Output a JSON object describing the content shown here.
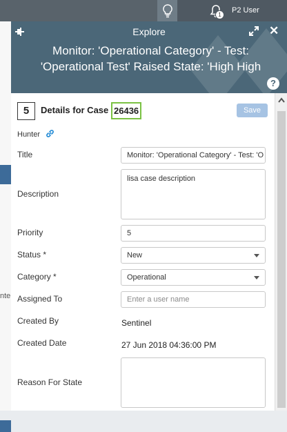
{
  "topbar": {
    "user": "P2 User",
    "notification_count": "1",
    "icons": [
      "lightbulb-icon",
      "bell-icon"
    ]
  },
  "panel": {
    "header": "Explore",
    "subtitle": "Monitor: 'Operational Category' - Test: 'Operational Test' Raised State: 'High High",
    "help": "?",
    "close": "✕"
  },
  "case": {
    "number_box": "5",
    "details_label": "Details for Case",
    "case_id": "26436",
    "save_label": "Save",
    "hunter_label": "Hunter"
  },
  "form": {
    "title_label": "Title",
    "title_value": "Monitor: 'Operational Category' - Test: 'O",
    "description_label": "Description",
    "description_value": "lisa case description",
    "priority_label": "Priority",
    "priority_value": "5",
    "status_label": "Status *",
    "status_value": "New",
    "category_label": "Category *",
    "category_value": "Operational",
    "assigned_label": "Assigned To",
    "assigned_placeholder": "Enter a user name",
    "created_by_label": "Created By",
    "created_by_value": "Sentinel",
    "created_date_label": "Created Date",
    "created_date_value": "27 Jun 2018 04:36:00 PM",
    "reason_label": "Reason For State"
  },
  "background": {
    "cut_text": "nte"
  },
  "colors": {
    "header_bg": "#4b6778",
    "topbar_bg": "#4f5962",
    "save_bg": "#a6c3e3",
    "highlight": "#7ac143"
  }
}
